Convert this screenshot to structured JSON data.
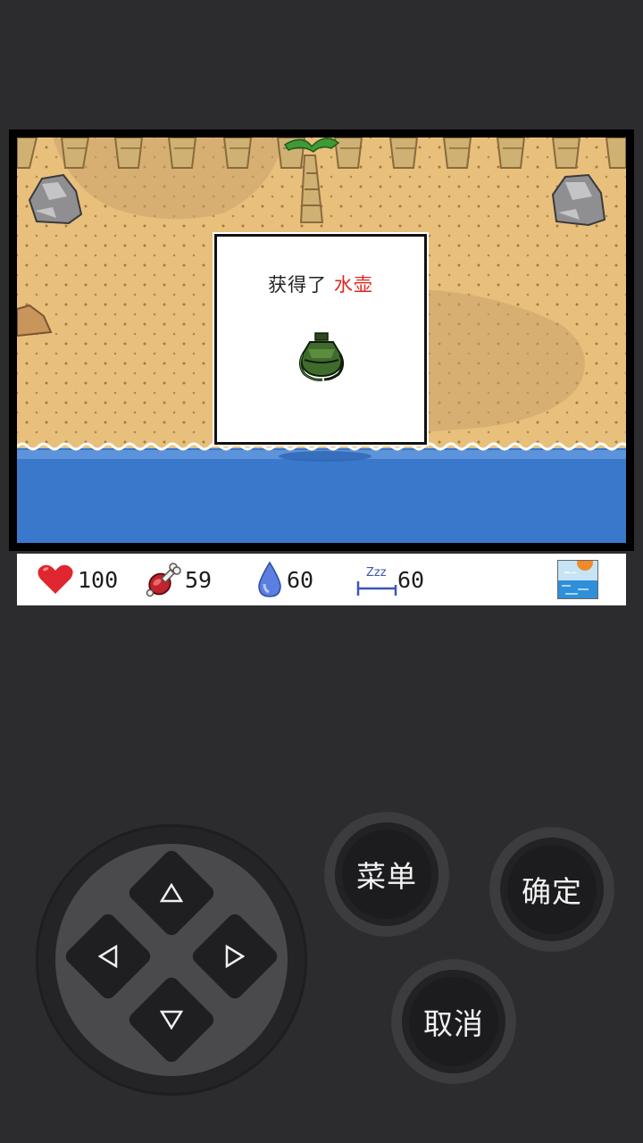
{
  "dialog": {
    "message_prefix": "获得了",
    "item_name": "水壶",
    "item_icon": "green-canteen-icon"
  },
  "status": {
    "health": "100",
    "food": "59",
    "water": "60",
    "sleep": "60",
    "sleep_label": "Zzz",
    "weather_icon": "sunny-sea-icon"
  },
  "controls": {
    "menu_label": "菜单",
    "confirm_label": "确定",
    "cancel_label": "取消"
  },
  "colors": {
    "background": "#2c2b2e",
    "sand": "#e8c07c",
    "sea": "#3a78cc",
    "item_highlight": "#e0261f",
    "heart": "#e0262e"
  }
}
